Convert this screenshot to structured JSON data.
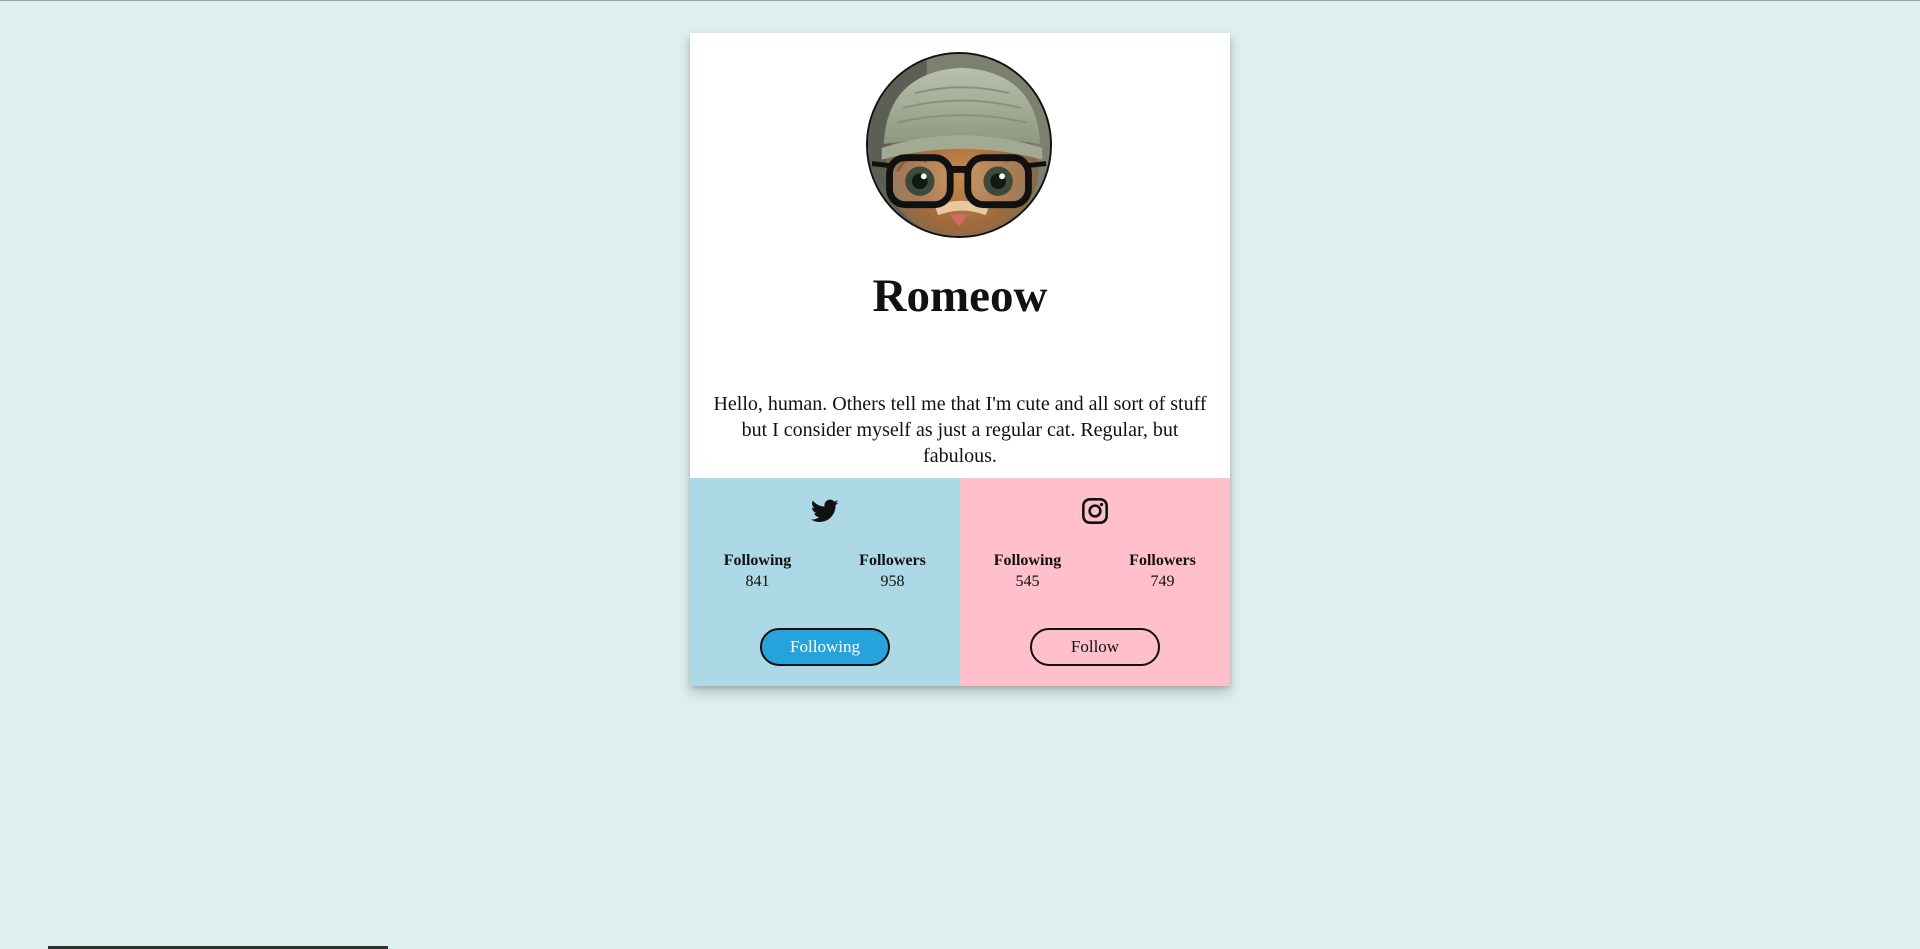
{
  "profile": {
    "name": "Romeow",
    "bio": "Hello, human. Others tell me that I'm cute and all sort of stuff but I consider myself as just a regular cat. Regular, but fabulous.",
    "avatar_icon": "cat-with-glasses-and-beanie"
  },
  "twitter": {
    "icon": "twitter-bird-icon",
    "following_label": "Following",
    "following_count": "841",
    "followers_label": "Followers",
    "followers_count": "958",
    "button_label": "Following"
  },
  "instagram": {
    "icon": "instagram-icon",
    "following_label": "Following",
    "following_count": "545",
    "followers_label": "Followers",
    "followers_count": "749",
    "button_label": "Follow"
  },
  "colors": {
    "page_background": "#ddf0ef",
    "twitter_panel": "#add8e6",
    "instagram_panel": "#ffc0cb",
    "following_button": "#27a3db"
  }
}
